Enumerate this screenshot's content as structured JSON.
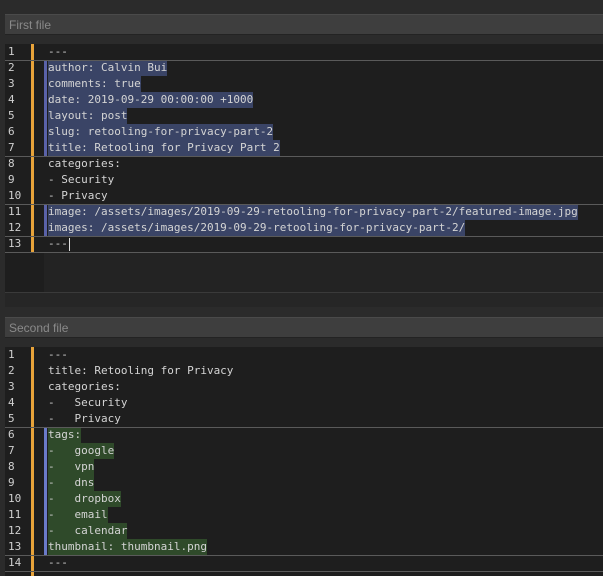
{
  "first_file": {
    "header": "First file",
    "lines": [
      {
        "n": "1",
        "text": "---",
        "hl": ""
      },
      {
        "n": "2",
        "text": "author: Calvin Bui",
        "hl": "blue"
      },
      {
        "n": "3",
        "text": "comments: true",
        "hl": "blue"
      },
      {
        "n": "4",
        "text": "date: 2019-09-29 00:00:00 +1000",
        "hl": "blue"
      },
      {
        "n": "5",
        "text": "layout: post",
        "hl": "blue"
      },
      {
        "n": "6",
        "text": "slug: retooling-for-privacy-part-2",
        "hl": "blue"
      },
      {
        "n": "7",
        "text": "title: Retooling for Privacy Part 2",
        "hl": "blue"
      },
      {
        "n": "8",
        "text": "categories:",
        "hl": ""
      },
      {
        "n": "9",
        "text": "- Security",
        "hl": ""
      },
      {
        "n": "10",
        "text": "- Privacy",
        "hl": ""
      },
      {
        "n": "11",
        "text": "image: /assets/images/2019-09-29-retooling-for-privacy-part-2/featured-image.jpg",
        "hl": "blue"
      },
      {
        "n": "12",
        "text": "images: /assets/images/2019-09-29-retooling-for-privacy-part-2/",
        "hl": "blue"
      },
      {
        "n": "13",
        "text": "---",
        "hl": "cursor"
      }
    ]
  },
  "second_file": {
    "header": "Second file",
    "lines": [
      {
        "n": "1",
        "text": "---",
        "hl": ""
      },
      {
        "n": "2",
        "text": "title: Retooling for Privacy",
        "hl": ""
      },
      {
        "n": "3",
        "text": "categories:",
        "hl": ""
      },
      {
        "n": "4",
        "text": "-   Security",
        "hl": ""
      },
      {
        "n": "5",
        "text": "-   Privacy",
        "hl": ""
      },
      {
        "n": "6",
        "text": "tags:",
        "hl": "green"
      },
      {
        "n": "7",
        "text": "-   google",
        "hl": "green"
      },
      {
        "n": "8",
        "text": "-   vpn",
        "hl": "green"
      },
      {
        "n": "9",
        "text": "-   dns",
        "hl": "green"
      },
      {
        "n": "10",
        "text": "-   dropbox",
        "hl": "green"
      },
      {
        "n": "11",
        "text": "-   email",
        "hl": "green"
      },
      {
        "n": "12",
        "text": "-   calendar",
        "hl": "green"
      },
      {
        "n": "13",
        "text": "thumbnail: thumbnail.png",
        "hl": "green"
      },
      {
        "n": "14",
        "text": "---",
        "hl": ""
      }
    ]
  },
  "colors": {
    "change_bar": "#e8a33a",
    "added_blue": "#3a4466",
    "added_green": "#2f4a2a"
  }
}
